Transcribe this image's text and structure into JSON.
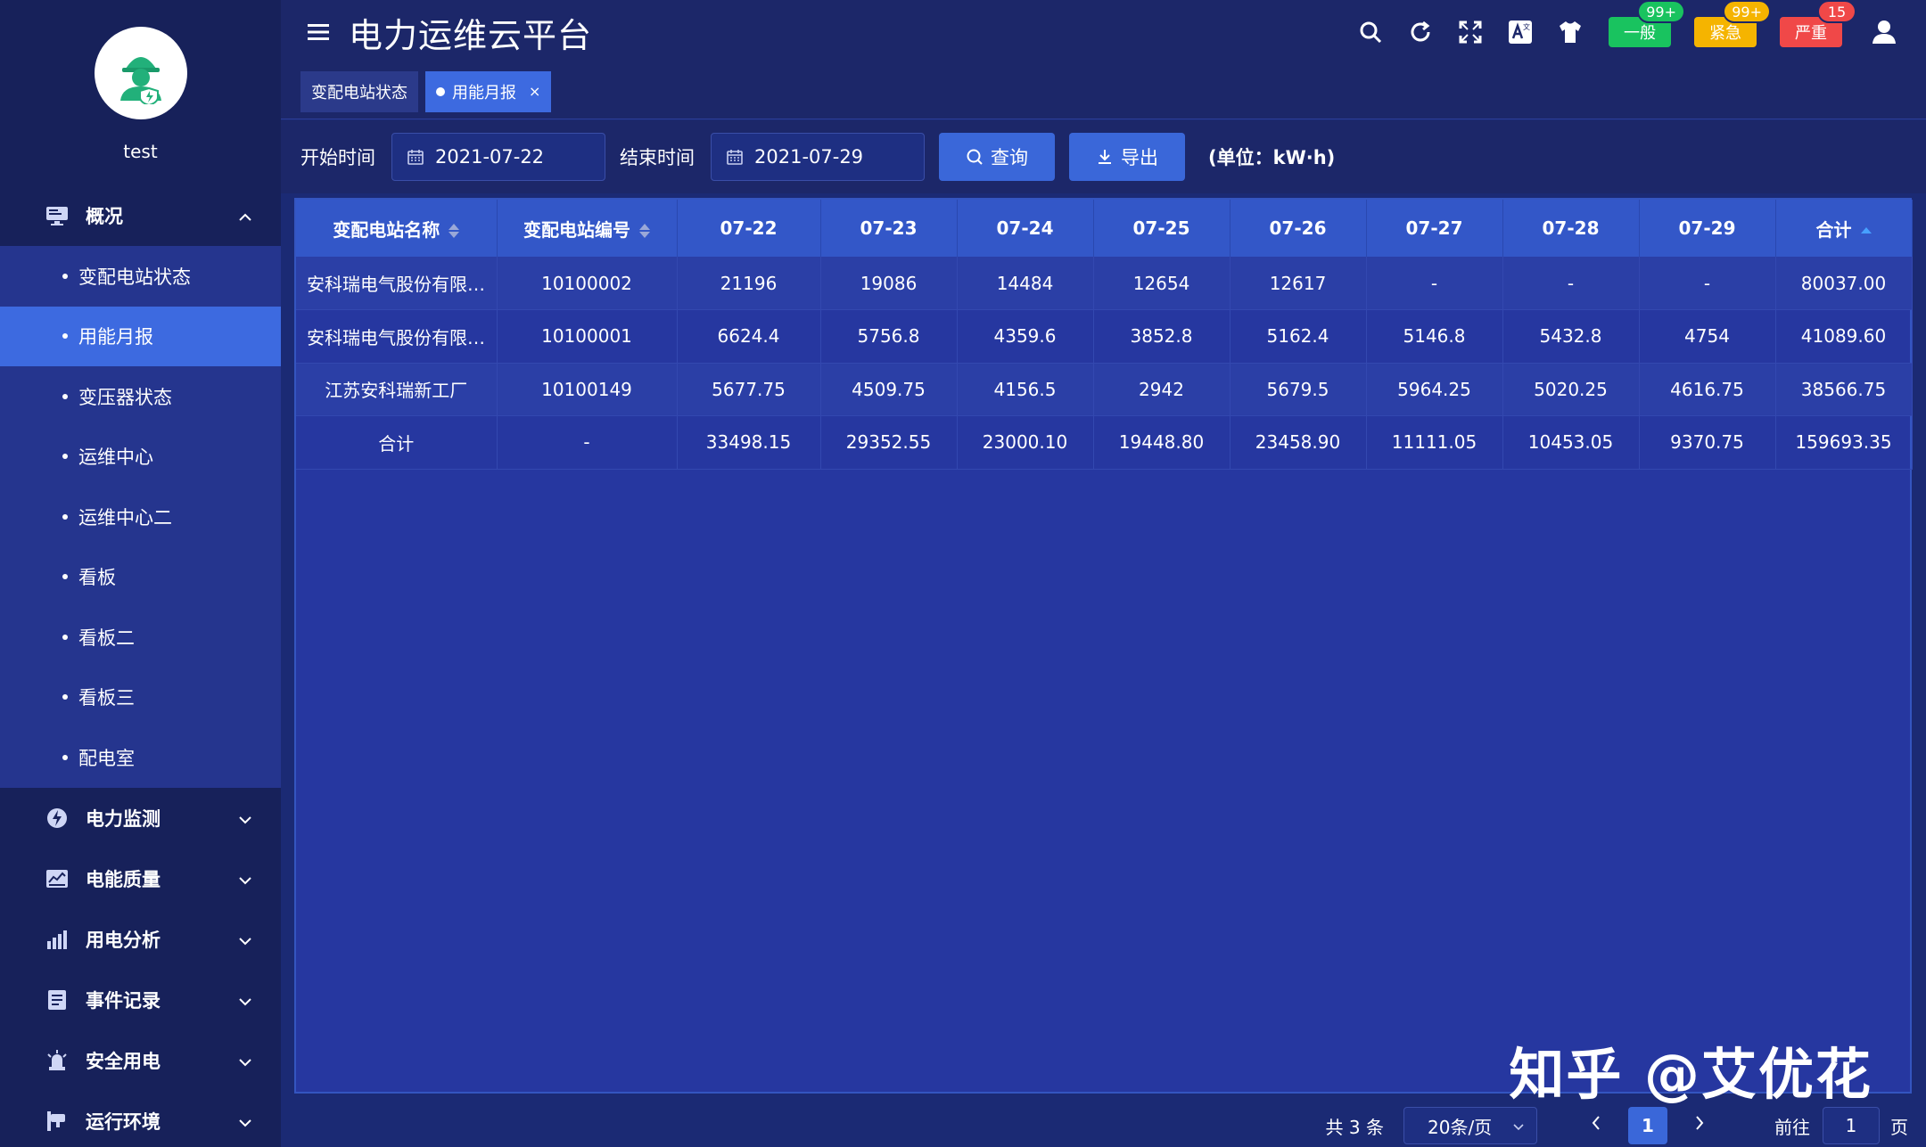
{
  "user": {
    "name": "test"
  },
  "app": {
    "title": "电力运维云平台"
  },
  "sidebar": {
    "groups": [
      {
        "label": "概况",
        "expanded": true,
        "items": [
          "变配电站状态",
          "用能月报",
          "变压器状态",
          "运维中心",
          "运维中心二",
          "看板",
          "看板二",
          "看板三",
          "配电室"
        ],
        "active": "用能月报"
      },
      {
        "label": "电力监测"
      },
      {
        "label": "电能质量"
      },
      {
        "label": "用电分析"
      },
      {
        "label": "事件记录"
      },
      {
        "label": "安全用电"
      },
      {
        "label": "运行环境"
      }
    ]
  },
  "header": {
    "alarms": [
      {
        "label": "一般",
        "badge": "99+",
        "color": "#19c35f"
      },
      {
        "label": "紧急",
        "badge": "99+",
        "color": "#f5b400"
      },
      {
        "label": "严重",
        "badge": "15",
        "color": "#f04848"
      }
    ]
  },
  "tabs": [
    {
      "label": "变配电站状态",
      "active": false
    },
    {
      "label": "用能月报",
      "active": true,
      "close": "×"
    }
  ],
  "filters": {
    "start_label": "开始时间",
    "start_value": "2021-07-22",
    "end_label": "结束时间",
    "end_value": "2021-07-29",
    "query_label": "查询",
    "export_label": "导出",
    "unit": "(单位：kW·h)"
  },
  "table": {
    "columns": [
      "变配电站名称",
      "变配电站编号",
      "07-22",
      "07-23",
      "07-24",
      "07-25",
      "07-26",
      "07-27",
      "07-28",
      "07-29",
      "合计"
    ],
    "rows": [
      [
        "安科瑞电气股份有限公司",
        "10100002",
        "21196",
        "19086",
        "14484",
        "12654",
        "12617",
        "-",
        "-",
        "-",
        "80037.00"
      ],
      [
        "安科瑞电气股份有限公司",
        "10100001",
        "6624.4",
        "5756.8",
        "4359.6",
        "3852.8",
        "5162.4",
        "5146.8",
        "5432.8",
        "4754",
        "41089.60"
      ],
      [
        "江苏安科瑞新工厂",
        "10100149",
        "5677.75",
        "4509.75",
        "4156.5",
        "2942",
        "5679.5",
        "5964.25",
        "5020.25",
        "4616.75",
        "38566.75"
      ],
      [
        "合计",
        "-",
        "33498.15",
        "29352.55",
        "23000.10",
        "19448.80",
        "23458.90",
        "11111.05",
        "10453.05",
        "9370.75",
        "159693.35"
      ]
    ]
  },
  "watermark": "知乎 @艾优花",
  "pagination": {
    "total": "共 3 条",
    "page_size": "20条/页",
    "current": "1",
    "goto_label": "前往",
    "goto_value": "1",
    "page_suffix": "页"
  }
}
